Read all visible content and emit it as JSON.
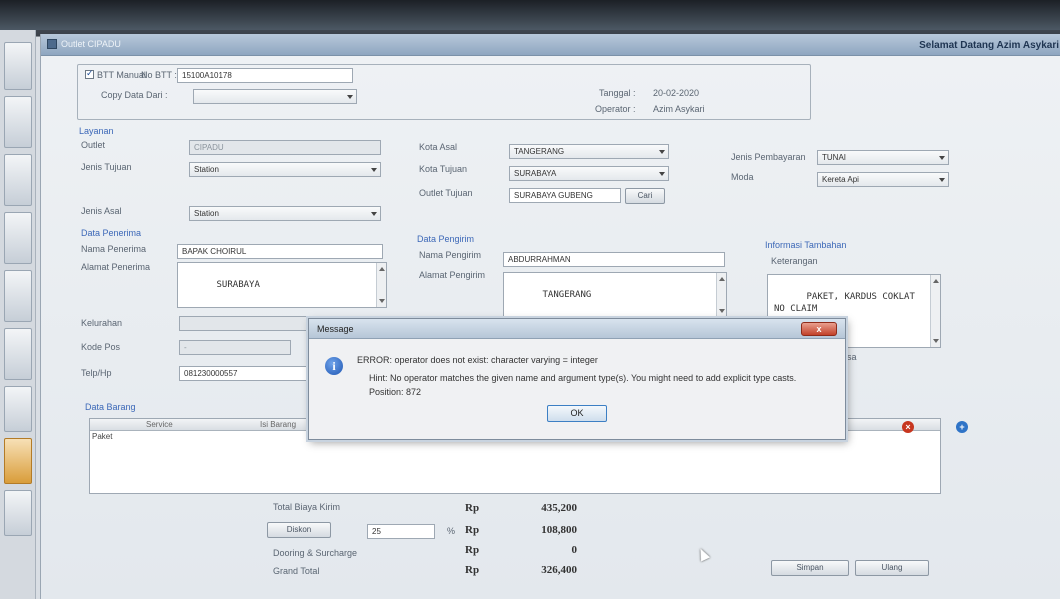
{
  "window": {
    "title": "Outlet CIPADU",
    "welcome": "Selamat Datang Azim Asykari"
  },
  "header": {
    "btt_manual_label": "BTT Manual",
    "no_btt_label": "No BTT :",
    "no_btt_value": "15100A10178",
    "copy_data_label": "Copy Data Dari :",
    "copy_data_value": "",
    "tanggal_label": "Tanggal :",
    "tanggal_value": "20-02-2020",
    "operator_label": "Operator :",
    "operator_value": "Azim Asykari"
  },
  "layanan": {
    "section_label": "Layanan",
    "outlet_label": "Outlet",
    "outlet_value": "CIPADU",
    "jenis_tujuan_label": "Jenis Tujuan",
    "jenis_tujuan_value": "Station",
    "jenis_asal_label": "Jenis Asal",
    "jenis_asal_value": "Station",
    "kota_asal_label": "Kota Asal",
    "kota_asal_value": "TANGERANG",
    "kota_tujuan_label": "Kota Tujuan",
    "kota_tujuan_value": "SURABAYA",
    "outlet_tujuan_label": "Outlet Tujuan",
    "outlet_tujuan_value": "SURABAYA GUBENG",
    "cari_label": "Cari",
    "jenis_pembayaran_label": "Jenis Pembayaran",
    "jenis_pembayaran_value": "TUNAI",
    "moda_label": "Moda",
    "moda_value": "Kereta Api"
  },
  "penerima": {
    "section_label": "Data Penerima",
    "nama_label": "Nama Penerima",
    "nama_value": "BAPAK CHOIRUL",
    "alamat_label": "Alamat Penerima",
    "alamat_value": "SURABAYA",
    "kelurahan_label": "Kelurahan",
    "kelurahan_value": "",
    "kode_pos_label": "Kode Pos",
    "kode_pos_value": "-",
    "telp_label": "Telp/Hp",
    "telp_value": "081230000557"
  },
  "pengirim": {
    "section_label": "Data Pengirim",
    "nama_label": "Nama Pengirim",
    "nama_value": "ABDURRAHMAN",
    "alamat_label": "Alamat Pengirim",
    "alamat_value": "TANGERANG"
  },
  "informasi": {
    "section_label": "Informasi Tambahan",
    "keterangan_label": "Keterangan",
    "keterangan_value": "PAKET, KARDUS COKLAT\nNO CLAIM\nS-S",
    "partial_label": "isa"
  },
  "barang": {
    "section_label": "Data Barang",
    "columns": [
      "Service",
      "Isi Barang"
    ],
    "rows": [
      [
        "Paket",
        ""
      ]
    ]
  },
  "totals": {
    "total_biaya_label": "Total Biaya Kirim",
    "diskon_label": "Diskon",
    "diskon_pct": "25",
    "percent_sign": "%",
    "dooring_label": "Dooring & Surcharge",
    "grand_total_label": "Grand Total",
    "currency": "Rp",
    "total_biaya_value": "435,200",
    "diskon_value": "108,800",
    "dooring_value": "0",
    "grand_total_value": "326,400"
  },
  "actions": {
    "simpan_label": "Simpan",
    "ulang_label": "Ulang"
  },
  "dialog": {
    "title": "Message",
    "close_label": "x",
    "line1": "ERROR: operator does not exist: character varying = integer",
    "line2": "Hint: No operator matches the given name and argument type(s). You might need to add explicit type casts.",
    "line3": "Position: 872",
    "ok_label": "OK"
  },
  "icons": {
    "info": "i",
    "remove": "×",
    "add": "+"
  }
}
